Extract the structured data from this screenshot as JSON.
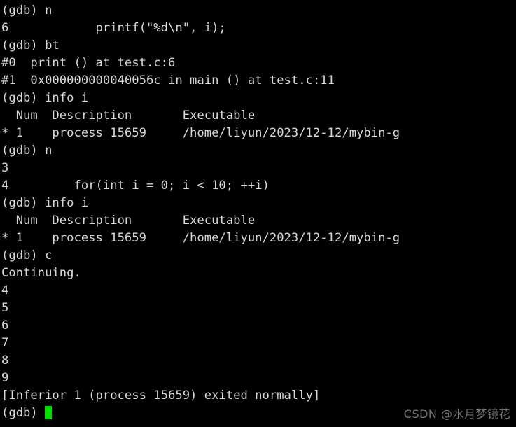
{
  "terminal": {
    "background_color": "#000000",
    "foreground_color": "#d8d8d8",
    "cursor_color": "#00e000",
    "lines": [
      "(gdb) n",
      "6            printf(\"%d\\n\", i);",
      "(gdb) bt",
      "#0  print () at test.c:6",
      "#1  0x000000000040056c in main () at test.c:11",
      "(gdb) info i",
      "  Num  Description       Executable",
      "* 1    process 15659     /home/liyun/2023/12-12/mybin-g",
      "(gdb) n",
      "3",
      "4         for(int i = 0; i < 10; ++i)",
      "(gdb) info i",
      "  Num  Description       Executable",
      "* 1    process 15659     /home/liyun/2023/12-12/mybin-g",
      "(gdb) c",
      "Continuing.",
      "4",
      "5",
      "6",
      "7",
      "8",
      "9",
      "[Inferior 1 (process 15659) exited normally]"
    ],
    "prompt": "(gdb) ",
    "cursor_name": "text-cursor"
  },
  "watermark": {
    "text": "CSDN @水月梦镜花",
    "color": "#8a8a8a"
  }
}
